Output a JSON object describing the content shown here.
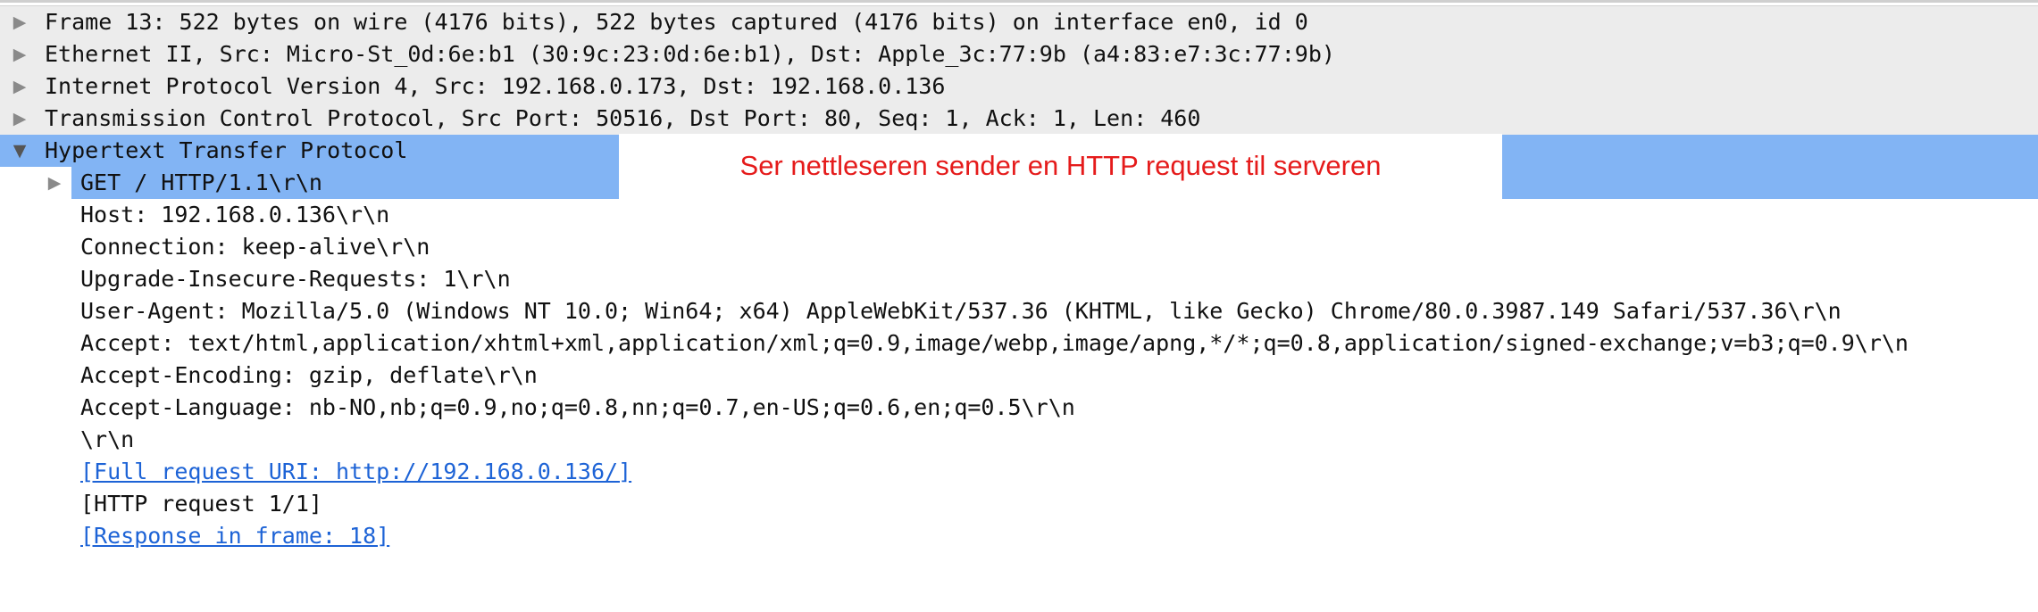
{
  "packet_details": {
    "frame": "Frame 13: 522 bytes on wire (4176 bits), 522 bytes captured (4176 bits) on interface en0, id 0",
    "ethernet": "Ethernet II, Src: Micro-St_0d:6e:b1 (30:9c:23:0d:6e:b1), Dst: Apple_3c:77:9b (a4:83:e7:3c:77:9b)",
    "ip": "Internet Protocol Version 4, Src: 192.168.0.173, Dst: 192.168.0.136",
    "tcp": "Transmission Control Protocol, Src Port: 50516, Dst Port: 80, Seq: 1, Ack: 1, Len: 460",
    "http": {
      "label": "Hypertext Transfer Protocol",
      "request_line": "GET / HTTP/1.1\\r\\n",
      "host": "Host: 192.168.0.136\\r\\n",
      "connection": "Connection: keep-alive\\r\\n",
      "upgrade": "Upgrade-Insecure-Requests: 1\\r\\n",
      "user_agent": "User-Agent: Mozilla/5.0 (Windows NT 10.0; Win64; x64) AppleWebKit/537.36 (KHTML, like Gecko) Chrome/80.0.3987.149 Safari/537.36\\r\\n",
      "accept": "Accept: text/html,application/xhtml+xml,application/xml;q=0.9,image/webp,image/apng,*/*;q=0.8,application/signed-exchange;v=b3;q=0.9\\r\\n",
      "accept_encoding": "Accept-Encoding: gzip, deflate\\r\\n",
      "accept_language": "Accept-Language: nb-NO,nb;q=0.9,no;q=0.8,nn;q=0.7,en-US;q=0.6,en;q=0.5\\r\\n",
      "crlf": "\\r\\n",
      "full_uri": "[Full request URI: http://192.168.0.136/]",
      "request_count": "[HTTP request 1/1]",
      "response_frame": "[Response in frame: 18]"
    }
  },
  "annotation": {
    "text": "Ser nettleseren sender en HTTP request til serveren",
    "color": "#e51b1b"
  },
  "icons": {
    "collapsed": "▶",
    "expanded": "▼"
  },
  "colors": {
    "selection": "#82b4f4",
    "header_row": "#ececec",
    "link": "#1d63d6"
  }
}
